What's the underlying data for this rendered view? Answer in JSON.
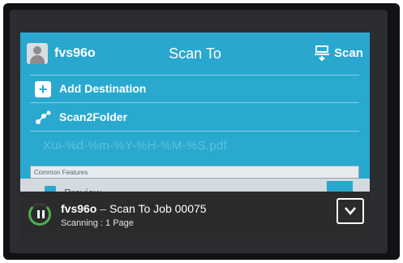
{
  "header": {
    "user_name": "fvs96o",
    "title": "Scan To",
    "scan_label": "Scan"
  },
  "destinations": [
    {
      "label": "Add Destination",
      "icon": "plus-icon"
    },
    {
      "label": "Scan2Folder",
      "icon": "network-folder-icon"
    }
  ],
  "file_name": "Xui-%d-%m-%Y-%H-%M-%S.pdf",
  "common_features_label": "Common Features",
  "preview_label": "Preview",
  "status": {
    "job_user": "fvs96o",
    "job_desc": "Scan To Job 00075",
    "progress": "Scanning : 1 Page"
  },
  "colors": {
    "accent": "#2aa7cf",
    "status_bar": "#2b2a2c",
    "progress_ring": "#4fb04f"
  }
}
